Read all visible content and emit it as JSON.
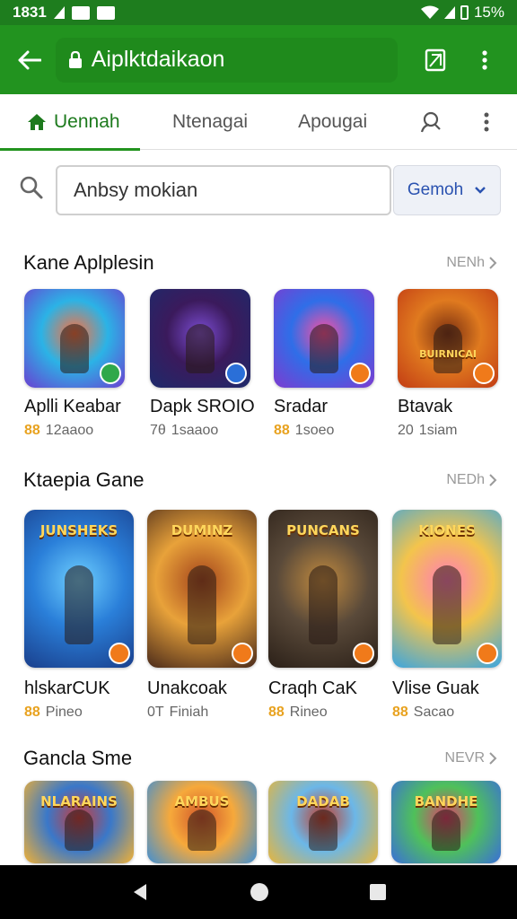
{
  "status": {
    "time": "1831",
    "battery_pct": "15%"
  },
  "app_bar": {
    "url": "Aiplktdaikaon"
  },
  "tabs": [
    {
      "label": "Uennah"
    },
    {
      "label": "Ntenagai"
    },
    {
      "label": "Apougai"
    }
  ],
  "search": {
    "value": "Anbsy mokian",
    "button_label": "Gemoh"
  },
  "sections": [
    {
      "title": "Kane Aplplesin",
      "more": "NENh",
      "items": [
        {
          "name": "Aplli Keabar",
          "meta": "12aaoo",
          "meta_icon": "88",
          "art_colors": [
            "#2bb3e6",
            "#ff6f3c",
            "#6a3fd1"
          ]
        },
        {
          "name": "Dapk SROIO",
          "meta": "1saaoo",
          "meta_icon": "7θ",
          "art_colors": [
            "#3b1a5c",
            "#7c4dd4",
            "#1d2a6b"
          ]
        },
        {
          "name": "Sradar",
          "meta": "1soeo",
          "meta_icon": "88",
          "art_colors": [
            "#2f6ee8",
            "#ff4fa0",
            "#7e3bd0"
          ]
        },
        {
          "name": "Btavak",
          "meta": "1siam",
          "meta_icon": "20",
          "art_colors": [
            "#e07a1f",
            "#7a2f10",
            "#c23c14"
          ],
          "art_text": "BUIRNICAI"
        }
      ]
    },
    {
      "title": "Ktaepia Gane",
      "more": "NEDh",
      "items": [
        {
          "name": "hlskarCUK",
          "meta": "Pineo",
          "meta_icon": "88",
          "art_colors": [
            "#2a7fd9",
            "#6fd0ff",
            "#1a3f8c"
          ],
          "art_text": "JUNSHEKS"
        },
        {
          "name": "Unakcoak",
          "meta": "Finiah",
          "meta_icon": "0T",
          "art_colors": [
            "#e8a23a",
            "#a3431b",
            "#4a2a1a"
          ],
          "art_text": "DUMINZ"
        },
        {
          "name": "Craqh CaK",
          "meta": "Rineo",
          "meta_icon": "88",
          "art_colors": [
            "#5a4a3a",
            "#c28b3f",
            "#2b2018"
          ],
          "art_text": "PUNCANS"
        },
        {
          "name": "Vlise Guak",
          "meta": "Sacao",
          "meta_icon": "88",
          "art_colors": [
            "#f3c44c",
            "#ff7db8",
            "#3aa5e0"
          ],
          "art_text": "KIONES"
        }
      ]
    },
    {
      "title": "Gancla Sme",
      "more": "NEVR",
      "items": [
        {
          "art_colors": [
            "#3a78c9",
            "#c93a3a",
            "#f2b134"
          ],
          "art_text": "NLARAINS"
        },
        {
          "art_colors": [
            "#f6a93b",
            "#d0542a",
            "#3f8fd4"
          ],
          "art_text": "AMBUS"
        },
        {
          "art_colors": [
            "#6bb7e8",
            "#c23c2a",
            "#e8b53a"
          ],
          "art_text": "DADAB"
        },
        {
          "art_colors": [
            "#4fc15a",
            "#e03a6a",
            "#3a6fd8"
          ],
          "art_text": "BANDHE"
        }
      ]
    }
  ],
  "colors": {
    "brand_green": "#22931f",
    "status_green": "#1e7d1e",
    "accent_blue": "#2a52b0"
  }
}
